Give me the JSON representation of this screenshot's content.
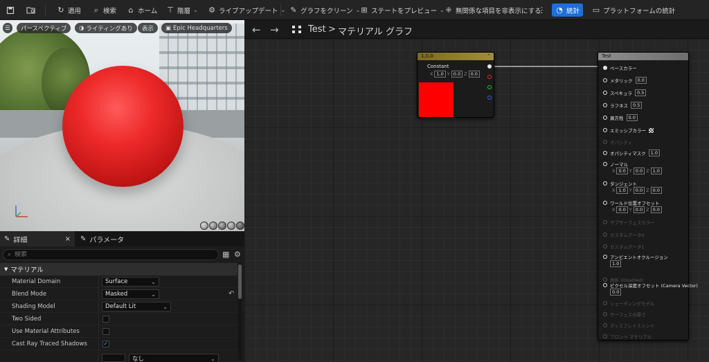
{
  "toolbar": {
    "apply": "適用",
    "search": "検索",
    "home": "ホーム",
    "hierarchy": "階層",
    "live_update": "ライブアップデート",
    "clean_graph": "グラフをクリーン",
    "preview_state": "ステートをプレビュー",
    "hide_unrelated": "無関係な項目を非表示にする",
    "stats": "統計",
    "platform_stats": "プラットフォームの統計"
  },
  "viewport": {
    "perspective": "パースペクティブ",
    "lighting": "ライティングあり",
    "show": "表示",
    "environment": "Epic Headquarters"
  },
  "details": {
    "tab_details": "詳細",
    "tab_parameters": "パラメータ",
    "search_placeholder": "検索",
    "section": "マテリアル",
    "properties": [
      {
        "label": "Material Domain",
        "value": "Surface"
      },
      {
        "label": "Blend Mode",
        "value": "Masked"
      },
      {
        "label": "Shading Model",
        "value": "Default Lit"
      },
      {
        "label": "Two Sided",
        "checked": false
      },
      {
        "label": "Use Material Attributes",
        "checked": false
      },
      {
        "label": "Cast Ray Traced Shadows",
        "checked": true
      }
    ],
    "last_row_value": "なし",
    "check_mark": "✓"
  },
  "graph": {
    "breadcrumb_root": "Test",
    "breadcrumb_separator": ">",
    "breadcrumb_current": "マテリアル グラフ",
    "constant_node": {
      "title": "1,0,0",
      "label": "Constant",
      "x_label": "X",
      "x": "1.0",
      "y_label": "Y",
      "y": "0.0",
      "z_label": "Z",
      "z": "0.0",
      "color": "#ff0000"
    },
    "material_node": {
      "title": "Test",
      "pins": [
        {
          "label": "ベースカラー"
        },
        {
          "label": "メタリック",
          "value": "0.0"
        },
        {
          "label": "スペキュラ",
          "value": "0.5"
        },
        {
          "label": "ラフネス",
          "value": "0.5"
        },
        {
          "label": "異方性",
          "value": "0.0"
        },
        {
          "label": "エミッシブカラー"
        },
        {
          "label": "オパシティ"
        },
        {
          "label": "オパシティマスク",
          "value": "1.0"
        },
        {
          "label": "ノーマル",
          "x": "0.0",
          "y": "0.0",
          "z": "1.0"
        },
        {
          "label": "タンジェント",
          "x": "1.0",
          "y": "0.0",
          "z": "0.0"
        },
        {
          "label": "ワールド位置オフセット",
          "x": "0.0",
          "y": "0.0",
          "z": "0.0"
        },
        {
          "label": "サブサーフェスカラー"
        },
        {
          "label": "カスタムデータ0"
        },
        {
          "label": "カスタムデータ1"
        },
        {
          "label": "アンビエントオクルージョン",
          "value": "1.0"
        },
        {
          "label": "屈折 (Disabled)"
        },
        {
          "label": "ピクセル深度オフセット (Camera Vector)",
          "value": "0.0"
        },
        {
          "label": "シェーディングモデル"
        },
        {
          "label": "サーフェスの厚さ"
        },
        {
          "label": "ディスプレイスメント"
        },
        {
          "label": "フロント マテリアル"
        }
      ],
      "xyz_labels": {
        "x": "X",
        "y": "Y",
        "z": "Z"
      }
    }
  },
  "colors": {
    "accent": "#1e6fd9",
    "constant_header": "#8b7a2e",
    "material_header": "#8a8a8a"
  }
}
